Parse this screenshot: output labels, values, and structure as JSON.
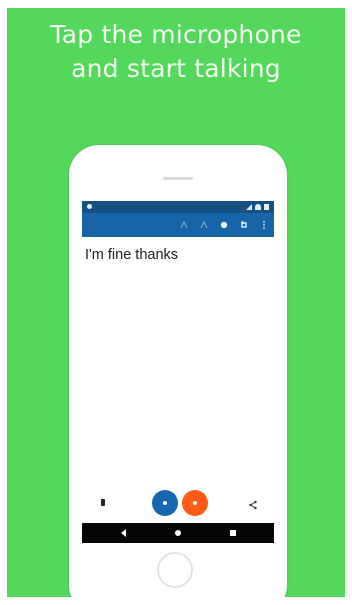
{
  "headline": {
    "line1": "Tap the microphone",
    "line2": "and start talking"
  },
  "screen": {
    "transcribed_text": "I'm fine thanks"
  },
  "icons": {
    "toolbar": [
      "paste-icon",
      "copy-icon",
      "settings-icon",
      "undo-icon",
      "more-vertical-icon"
    ],
    "status_bar": [
      "signal-icon",
      "wifi-icon",
      "battery-icon"
    ],
    "bottom_controls": [
      "phone-icon",
      "microphone-icon",
      "record-icon",
      "share-icon"
    ],
    "navigation": [
      "back-icon",
      "home-icon",
      "recent-apps-icon"
    ]
  },
  "colors": {
    "background": "#54d85b",
    "app_bar": "#1764a8",
    "status_bar": "#164f82",
    "mic_button": "#1767b0",
    "record_button": "#ff5a16",
    "nav_bar": "#050505"
  }
}
